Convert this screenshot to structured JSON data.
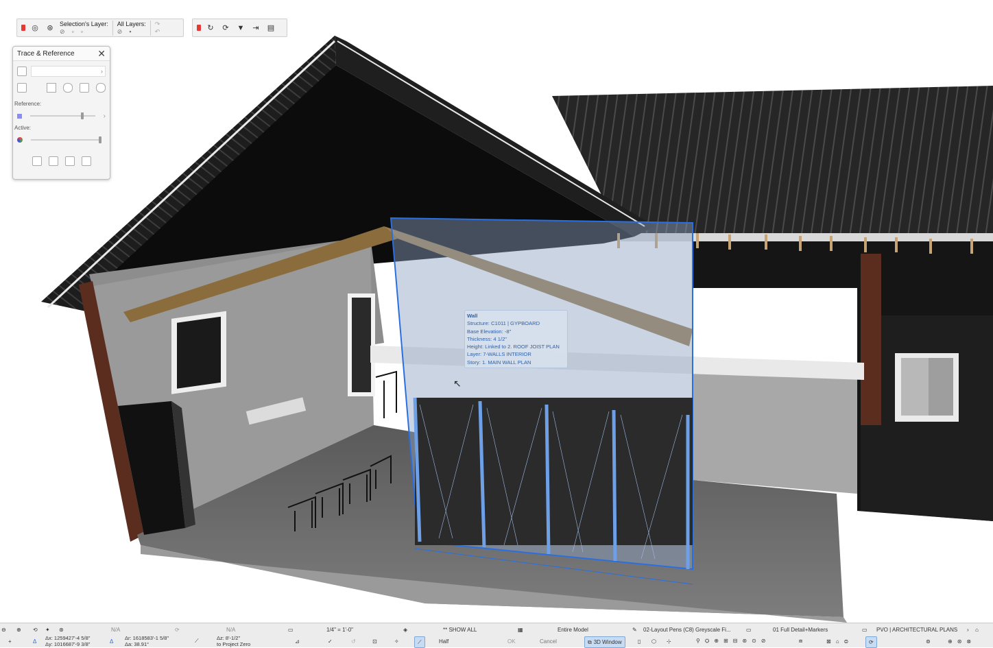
{
  "layer_toolbar": {
    "selection_layer_label": "Selection's Layer:",
    "all_layers_label": "All Layers:"
  },
  "trace_panel": {
    "title": "Trace & Reference",
    "reference_label": "Reference:",
    "active_label": "Active:"
  },
  "tooltip": {
    "title": "Wall",
    "lines": [
      "Structure: C1011 | GYPBOARD",
      "Base Elevation: -8\"",
      "Thickness: 4 1/2\"",
      "Height: Linked to 2. ROOF JOIST PLAN",
      "Layer: 7-WALLS INTERIOR",
      "Story: 1. MAIN WALL PLAN"
    ]
  },
  "status": {
    "na_1": "N/A",
    "na_2": "N/A",
    "scale": "1/4\"   =   1'-0\"",
    "show_all": "** SHOW ALL",
    "entire_model": "Entire Model",
    "pen_set": "02-Layout Pens (C8) Greyscale Fi...",
    "detail_markers": "01 Full Detail+Markers",
    "view_set": "PVO | ARCHITECTURAL PLANS",
    "coord_x": "Δx: 1259427'-4 5/8\"",
    "coord_y": "Δy: 1016687'-9 3/8\"",
    "coord_r": "Δr: 1618583'-1 5/8\"",
    "coord_a": "Δa: 38.91°",
    "coord_z": "Δz: 8'-1/2\"",
    "to_project_zero": "to Project Zero",
    "half": "Half",
    "ok": "OK",
    "cancel": "Cancel",
    "window_3d": "3D Window"
  },
  "colors": {
    "selection_blue": "#2a6fe0",
    "roof": "#232323",
    "wall_grey": "#8d8d8d",
    "floor": "#6a6a6a",
    "timber": "#c8a472"
  }
}
